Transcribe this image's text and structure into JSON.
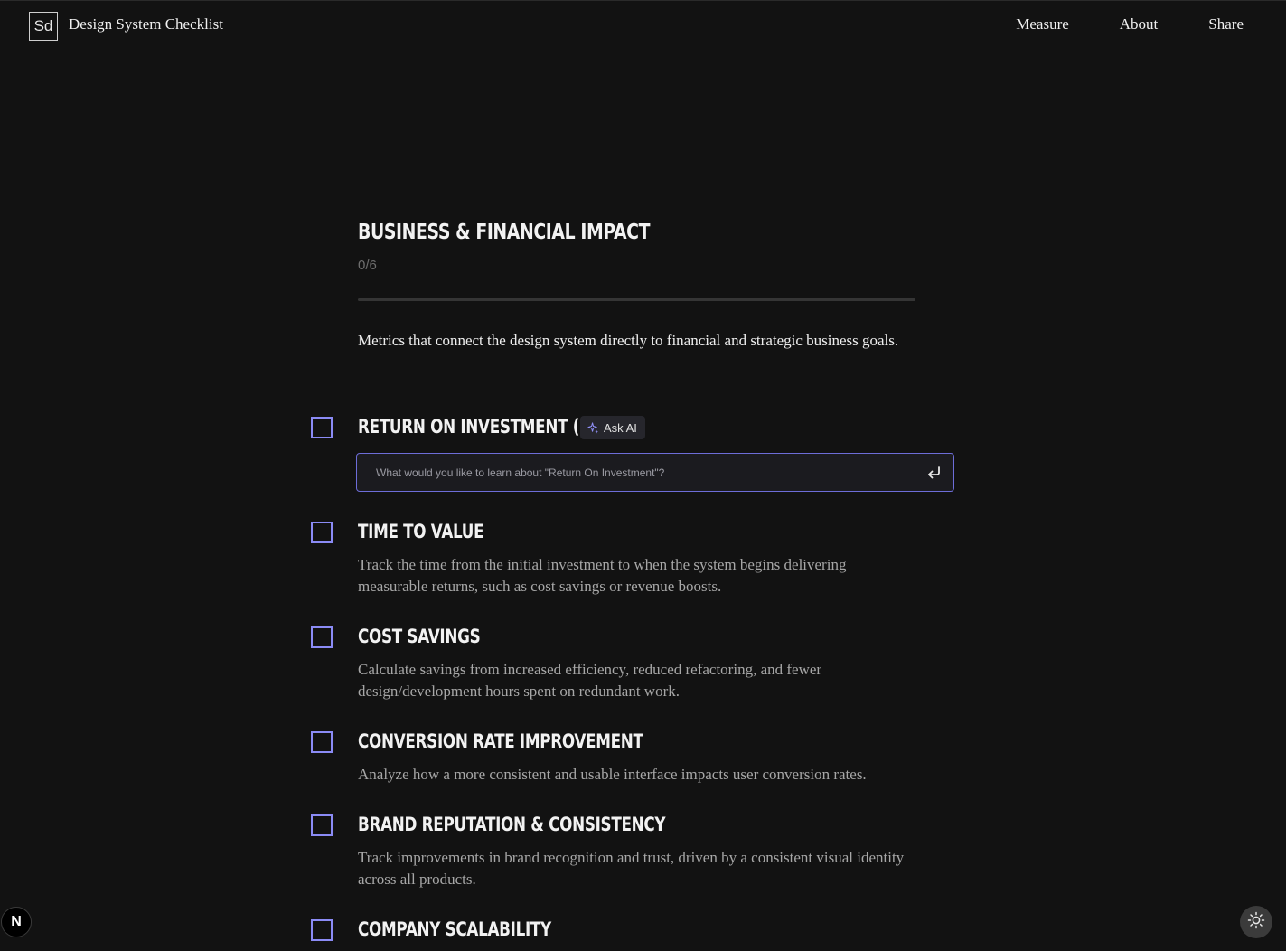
{
  "header": {
    "logo_text": "Sd",
    "title": "Design System Checklist",
    "nav": [
      "Measure",
      "About",
      "Share"
    ]
  },
  "section": {
    "title": "BUSINESS & FINANCIAL IMPACT",
    "progress_text": "0/6",
    "progress_fraction": 0,
    "description": "Metrics that connect the design system directly to financial and strategic business goals."
  },
  "items": [
    {
      "title": "RETURN ON INVESTMENT (ROI)",
      "checked": false,
      "ask_ai_label": "Ask AI",
      "ask_ai_placeholder": "What would you like to learn about \"Return On Investment\"?"
    },
    {
      "title": "TIME TO VALUE",
      "checked": false,
      "description": "Track the time from the initial investment to when the system begins delivering measurable returns, such as cost savings or revenue boosts."
    },
    {
      "title": "COST SAVINGS",
      "checked": false,
      "description": "Calculate savings from increased efficiency, reduced refactoring, and fewer design/development hours spent on redundant work."
    },
    {
      "title": "CONVERSION RATE IMPROVEMENT",
      "checked": false,
      "description": "Analyze how a more consistent and usable interface impacts user conversion rates."
    },
    {
      "title": "BRAND REPUTATION & CONSISTENCY",
      "checked": false,
      "description": "Track improvements in brand recognition and trust, driven by a consistent visual identity across all products."
    },
    {
      "title": "COMPANY SCALABILITY",
      "checked": false
    }
  ],
  "floating": {
    "n_badge": "N",
    "theme_icon": "sun-icon"
  },
  "colors": {
    "background": "#121212",
    "accent": "#8b8bf5",
    "muted_text": "#a7a7a7"
  }
}
